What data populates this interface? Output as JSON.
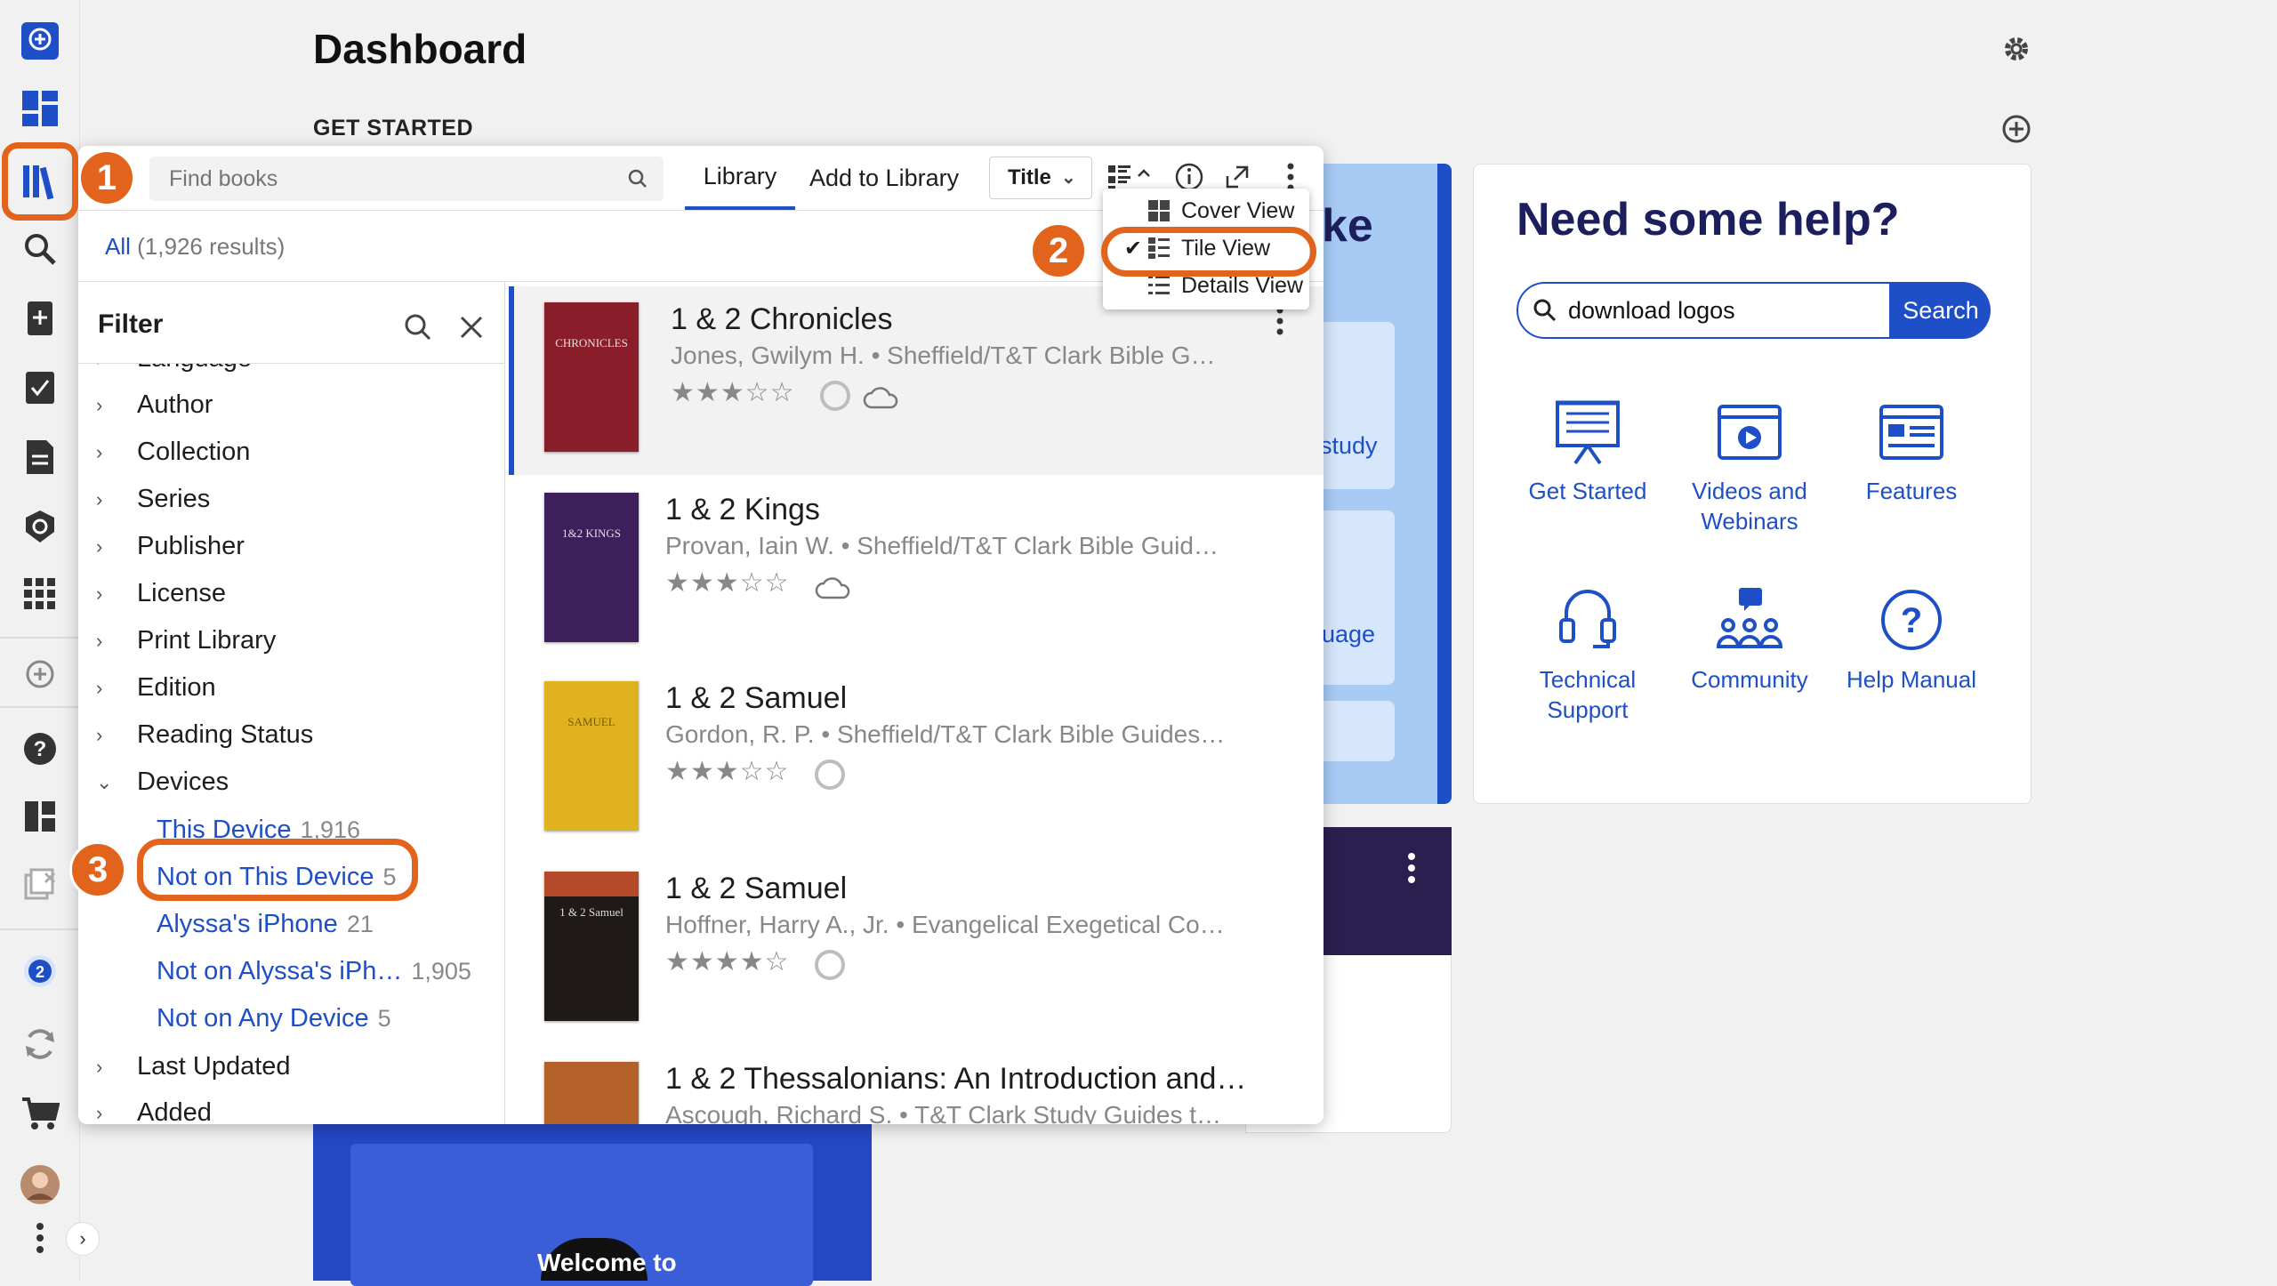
{
  "dashboard": {
    "title": "Dashboard",
    "section": "GET STARTED"
  },
  "library": {
    "search_placeholder": "Find books",
    "tabs": [
      "Library",
      "Add to Library"
    ],
    "sort": "Title",
    "results_all": "All",
    "results_count": "(1,926 results)",
    "view_menu": [
      "Cover View",
      "Tile View",
      "Details View"
    ],
    "selected_view": "Tile View"
  },
  "filter": {
    "title": "Filter",
    "partial_item": "Language",
    "items": [
      "Author",
      "Collection",
      "Series",
      "Publisher",
      "License",
      "Print Library",
      "Edition",
      "Reading Status",
      "Devices"
    ],
    "devices": [
      {
        "label": "This Device",
        "count": "1,916"
      },
      {
        "label": "Not on This Device",
        "count": "5"
      },
      {
        "label": "Alyssa's iPhone",
        "count": "21"
      },
      {
        "label": "Not on Alyssa's iPh…",
        "count": "1,905"
      },
      {
        "label": "Not on Any Device",
        "count": "5"
      }
    ],
    "items_after": [
      "Last Updated",
      "Added"
    ]
  },
  "books": [
    {
      "title": "1 & 2 Chronicles",
      "author": "Jones, Gwilym H. • Sheffield/T&T Clark Bible G…",
      "rating": 3,
      "cover_color": "#8a1d2a",
      "cover_text": "CHRONICLES"
    },
    {
      "title": "1 & 2 Kings",
      "author": "Provan, Iain W. • Sheffield/T&T Clark Bible Guid…",
      "rating": 3,
      "cover_color": "#3d1f5c",
      "cover_text": "1&2 KINGS"
    },
    {
      "title": "1 & 2 Samuel",
      "author": "Gordon, R. P. • Sheffield/T&T Clark Bible Guides…",
      "rating": 3,
      "cover_color": "#e0b21f",
      "cover_text": "SAMUEL"
    },
    {
      "title": "1 & 2 Samuel",
      "author": "Hoffner, Harry A., Jr. • Evangelical Exegetical Co…",
      "rating": 4,
      "cover_color": "#1f1a17",
      "cover_text": "1 & 2 Samuel"
    },
    {
      "title": "1 & 2 Thessalonians: An Introduction and…",
      "author": "Ascough, Richard S. • T&T Clark Study Guides t…",
      "rating": 0,
      "cover_color": "#b5612a",
      "cover_text": ""
    }
  ],
  "help": {
    "title": "Need some help?",
    "search_value": "download logos",
    "search_button": "Search",
    "items": [
      "Get Started",
      "Videos and Webinars",
      "Features",
      "Technical Support",
      "Community",
      "Help Manual"
    ]
  },
  "behind": {
    "blue_card_title_fragment": "ke",
    "fragment1": "study",
    "fragment2": "uage",
    "video_text": "Welcome to"
  },
  "annotations": [
    "1",
    "2",
    "3"
  ],
  "colors": {
    "accent": "#1e4fc6",
    "highlight": "#e2641c"
  }
}
